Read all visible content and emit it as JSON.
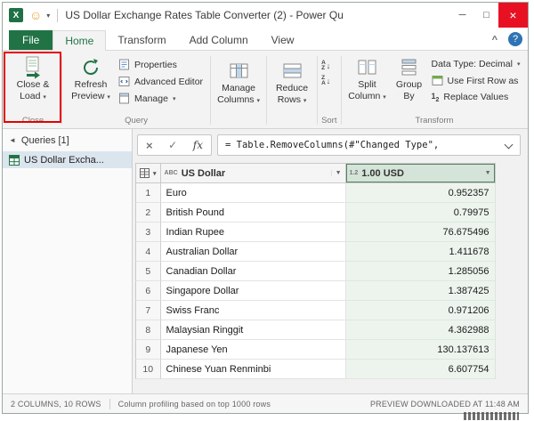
{
  "glyphs": {
    "caret": "▾",
    "filter": "▼",
    "check": "✓",
    "cross": "×",
    "arrow_down": "↓",
    "chevron_left": "◄"
  },
  "title_bar": {
    "app_icon": "X",
    "smiley": "☺",
    "qat_dropdown": "▾",
    "title": "US Dollar Exchange Rates Table Converter (2) - Power Qu",
    "minimize": "─",
    "maximize": "□",
    "close": "×"
  },
  "tabs": {
    "file": "File",
    "home": "Home",
    "transform": "Transform",
    "add_column": "Add Column",
    "view": "View",
    "collapse": "^",
    "help": "?"
  },
  "ribbon": {
    "close_group": {
      "label": "Close",
      "line1": "Close &",
      "line2": "Load"
    },
    "query_group": {
      "label": "Query",
      "refresh_line1": "Refresh",
      "refresh_line2": "Preview",
      "properties": "Properties",
      "advanced_editor": "Advanced Editor",
      "manage": "Manage"
    },
    "manage_columns": {
      "line1": "Manage",
      "line2": "Columns"
    },
    "reduce_rows": {
      "line1": "Reduce",
      "line2": "Rows"
    },
    "sort_group": {
      "label": "Sort",
      "a": "A",
      "z": "Z"
    },
    "transform_group": {
      "label": "Transform",
      "split_line1": "Split",
      "split_line2": "Column",
      "group_line1": "Group",
      "group_line2": "By",
      "data_type": "Data Type: Decimal",
      "use_first_row": "Use First Row as",
      "replace_icon_1": "1",
      "replace_icon_2": "2",
      "replace_values": "Replace Values"
    }
  },
  "queries_pane": {
    "header": "Queries [1]",
    "item": "US Dollar Excha..."
  },
  "formula_bar": {
    "fx": "fx",
    "formula": "= Table.RemoveColumns(#\"Changed Type\","
  },
  "grid": {
    "columns": [
      {
        "type": "ABC",
        "name": "US Dollar"
      },
      {
        "type": "1.2",
        "name": "1.00 USD"
      }
    ],
    "rows": [
      {
        "n": 1,
        "currency": "Euro",
        "rate": "0.952357"
      },
      {
        "n": 2,
        "currency": "British Pound",
        "rate": "0.79975"
      },
      {
        "n": 3,
        "currency": "Indian Rupee",
        "rate": "76.675496"
      },
      {
        "n": 4,
        "currency": "Australian Dollar",
        "rate": "1.411678"
      },
      {
        "n": 5,
        "currency": "Canadian Dollar",
        "rate": "1.285056"
      },
      {
        "n": 6,
        "currency": "Singapore Dollar",
        "rate": "1.387425"
      },
      {
        "n": 7,
        "currency": "Swiss Franc",
        "rate": "0.971206"
      },
      {
        "n": 8,
        "currency": "Malaysian Ringgit",
        "rate": "4.362988"
      },
      {
        "n": 9,
        "currency": "Japanese Yen",
        "rate": "130.137613"
      },
      {
        "n": 10,
        "currency": "Chinese Yuan Renminbi",
        "rate": "6.607754"
      }
    ]
  },
  "status_bar": {
    "columns_rows": "2 COLUMNS, 10 ROWS",
    "profiling": "Column profiling based on top 1000 rows",
    "preview": "PREVIEW DOWNLOADED AT 11:48 AM"
  }
}
